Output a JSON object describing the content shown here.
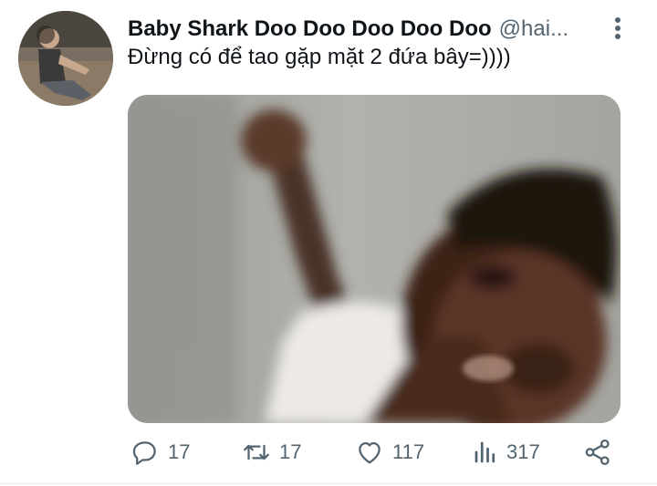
{
  "tweet": {
    "display_name": "Baby Shark Doo Doo Doo Doo Doo",
    "handle": "@hai...",
    "text": "Đừng có để tao gặp mặt 2 đứa bây=))))",
    "media_alt_visible": false
  },
  "actions": {
    "reply_count": "17",
    "retweet_count": "17",
    "like_count": "117",
    "view_count": "317"
  },
  "icons": {
    "more": "more-vertical-icon",
    "reply": "reply-icon",
    "retweet": "retweet-icon",
    "like": "heart-icon",
    "views": "views-chart-icon",
    "share": "share-icon"
  },
  "colors": {
    "text_primary": "#0f1419",
    "text_secondary": "#536471",
    "divider": "#e6ecf0"
  }
}
